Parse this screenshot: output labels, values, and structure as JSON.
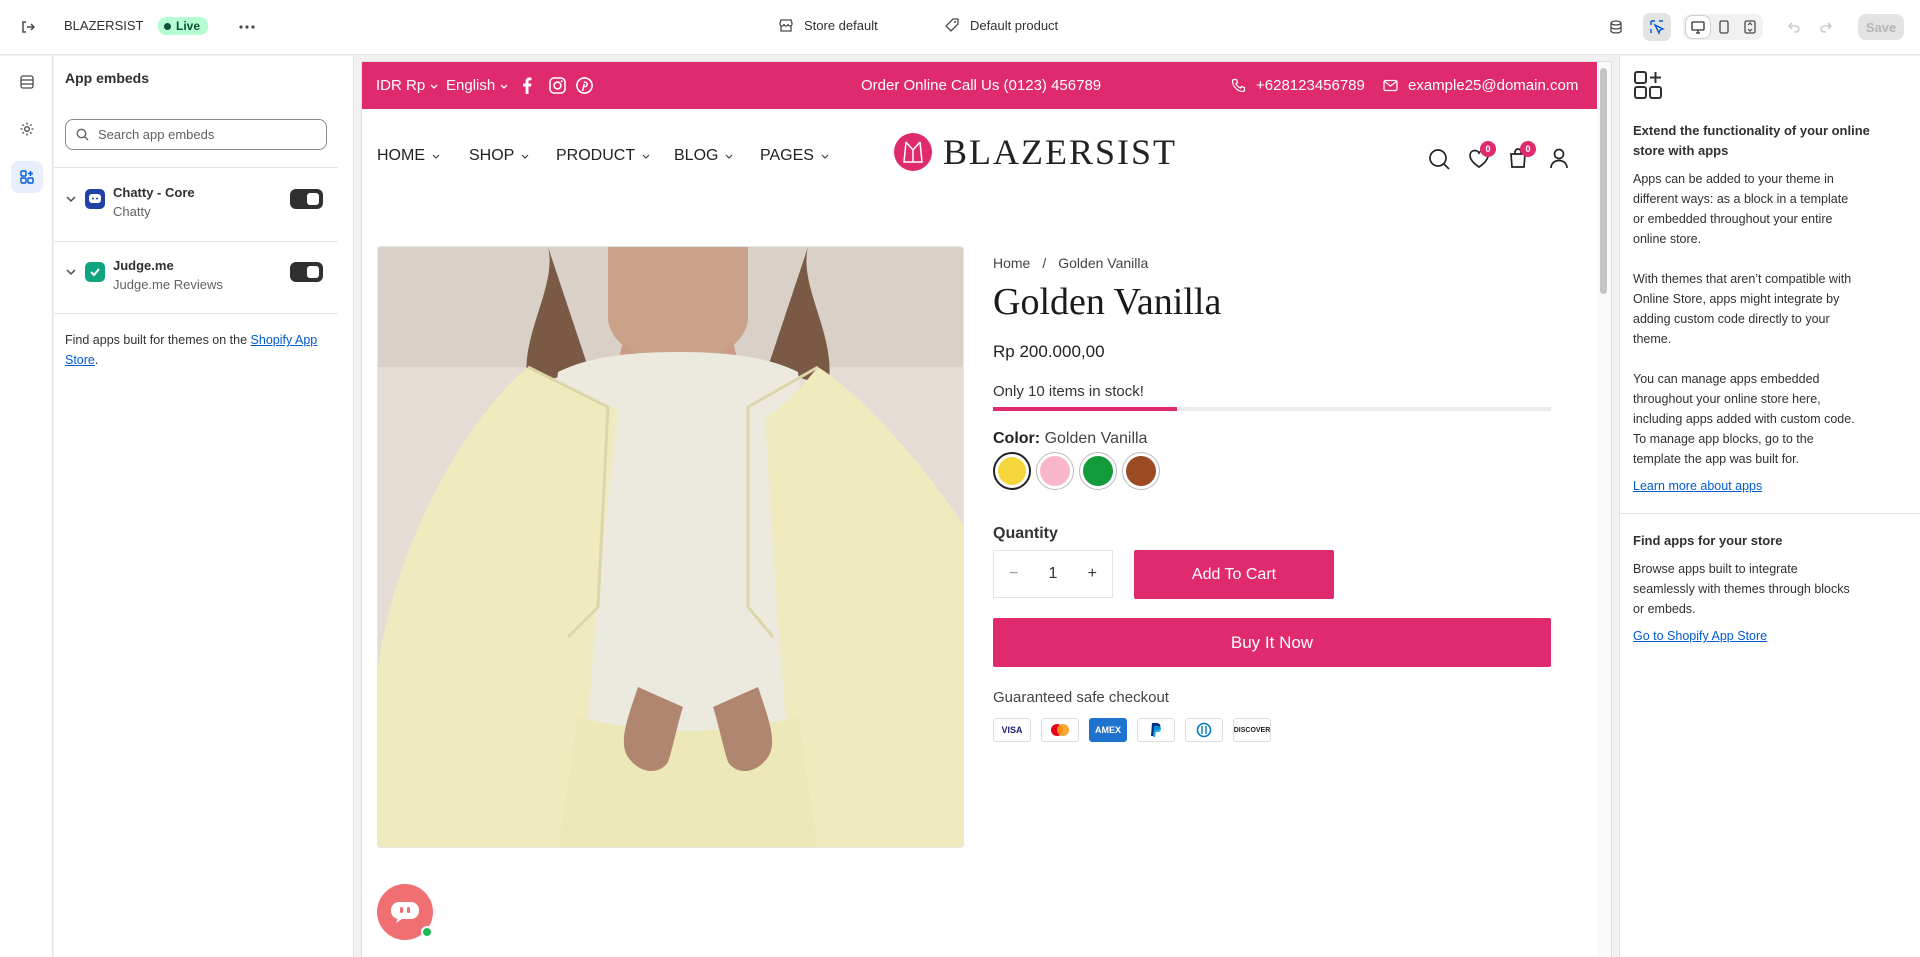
{
  "topbar": {
    "store_name": "BLAZERSIST",
    "status": "Live",
    "theme_selector": "Store default",
    "template_selector": "Default product",
    "save_label": "Save"
  },
  "left_rail": {
    "items": [
      "sections-icon",
      "settings-icon",
      "app-embeds-icon"
    ],
    "active": "app-embeds-icon"
  },
  "panel": {
    "title": "App embeds",
    "search_placeholder": "Search app embeds",
    "apps": [
      {
        "title": "Chatty - Core",
        "subtitle": "Chatty",
        "enabled": true
      },
      {
        "title": "Judge.me",
        "subtitle": "Judge.me Reviews",
        "enabled": true
      }
    ],
    "find_text": "Find apps built for themes on the ",
    "find_link": "Shopify App Store",
    "find_end": "."
  },
  "store": {
    "announcement": {
      "currency": "IDR Rp",
      "language": "English",
      "center_text": "Order Online Call Us (0123) 456789",
      "phone": "+628123456789",
      "email": "example25@domain.com"
    },
    "menu": [
      "HOME",
      "SHOP",
      "PRODUCT",
      "BLOG",
      "PAGES"
    ],
    "logo_text": "BLAZERSIST",
    "wishlist_count": "0",
    "cart_count": "0",
    "breadcrumb": {
      "home": "Home",
      "sep": "/",
      "current": "Golden Vanilla"
    },
    "product": {
      "title": "Golden Vanilla",
      "price": "Rp 200.000,00",
      "stock_text": "Only 10 items in stock!",
      "stock_fraction": 0.33,
      "color_label": "Color:",
      "color_value": "Golden Vanilla",
      "swatches": [
        "#f5d63d",
        "#f9b6c8",
        "#119b3b",
        "#9b4a24"
      ],
      "quantity_label": "Quantity",
      "quantity": "1",
      "minus": "−",
      "plus": "+",
      "add_to_cart": "Add To Cart",
      "buy_now": "Buy It Now",
      "checkout_text": "Guaranteed safe checkout",
      "payment_methods": [
        "VISA",
        "MC",
        "AMEX",
        "PayPal",
        "Diners",
        "DISCOVER"
      ]
    }
  },
  "right_panel": {
    "heading1": "Extend the functionality of your online store with apps",
    "para1": "Apps can be added to your theme in different ways: as a block in a template or embedded throughout your entire online store.",
    "para2": "With themes that aren’t compatible with Online Store, apps might integrate by adding custom code directly to your theme.",
    "para3": "You can manage apps embedded throughout your online store here, including apps added with custom code. To manage app blocks, go to the template the app was built for.",
    "link1": "Learn more about apps",
    "heading2": "Find apps for your store",
    "para4": "Browse apps built to integrate seamlessly with themes through blocks or embeds.",
    "link2": "Go to Shopify App Store"
  },
  "colors": {
    "accent": "#df2a6e",
    "link": "#005bd3",
    "live_badge": "#b4fed2"
  }
}
